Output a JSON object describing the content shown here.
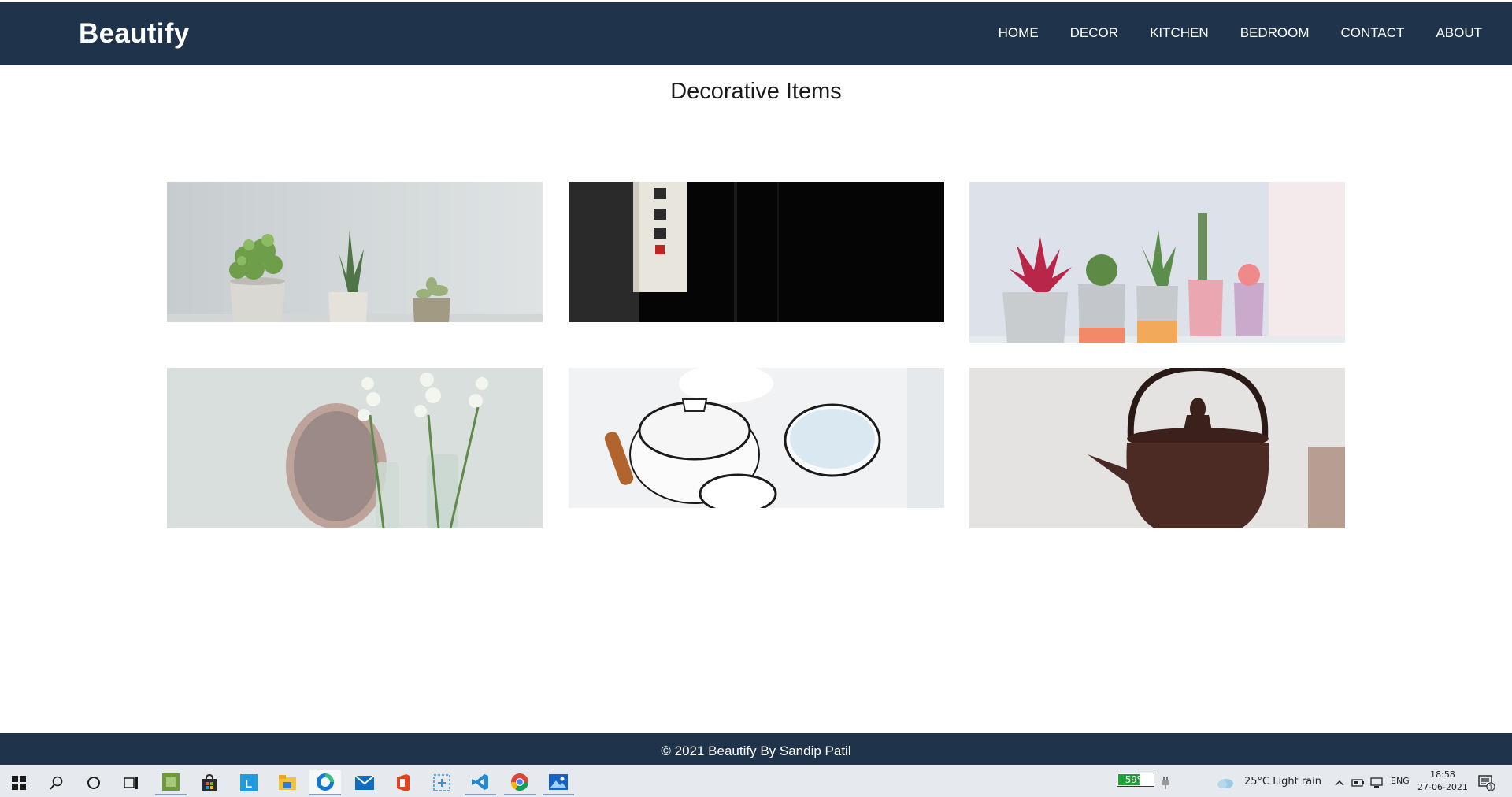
{
  "brand": "Beautify",
  "nav": [
    "HOME",
    "DECOR",
    "KITCHEN",
    "BEDROOM",
    "CONTACT",
    "ABOUT"
  ],
  "page_title": "Decorative Items",
  "gallery": [
    {
      "name": "potted-succulents-image"
    },
    {
      "name": "hanging-lantern-image"
    },
    {
      "name": "colorful-cactus-pots-image"
    },
    {
      "name": "flowers-vase-tray-image"
    },
    {
      "name": "enamel-cookware-image"
    },
    {
      "name": "cast-iron-teapot-image"
    }
  ],
  "footer": "© 2021 Beautify By Sandip Patil",
  "taskbar": {
    "apps": [
      "windows-start-icon",
      "search-icon",
      "cortana-icon",
      "task-view-icon",
      "app-green-icon",
      "store-icon",
      "l-app-icon",
      "file-explorer-icon",
      "edge-icon",
      "mail-icon",
      "office-icon",
      "snip-icon",
      "vscode-icon",
      "chrome-icon",
      "photos-icon"
    ],
    "battery_percent": "59%",
    "battery_level": 0.59,
    "weather": "25°C  Light rain",
    "language": "ENG",
    "time": "18:58",
    "date": "27-06-2021",
    "notifications": "1"
  }
}
